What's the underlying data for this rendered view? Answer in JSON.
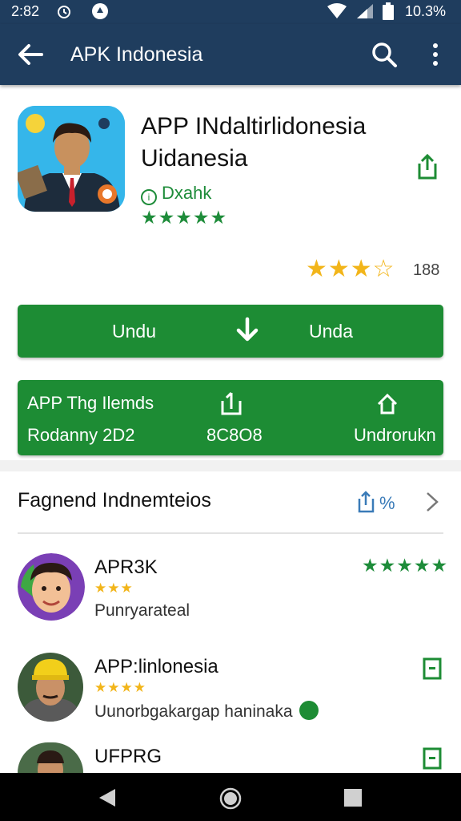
{
  "status": {
    "time": "2:82",
    "battery_text": "10.3%",
    "icons": [
      "alarm-icon",
      "notification-icon",
      "wifi-icon",
      "signal-icon",
      "battery-icon"
    ]
  },
  "appbar": {
    "title": "APK Indonesia",
    "icons": [
      "back-arrow-icon",
      "search-icon",
      "more-vert-icon"
    ]
  },
  "app": {
    "name_line1": "APP INdaltirlidonesia",
    "name_line2": "Uidanesia",
    "developer": "Dxahk",
    "developer_rating": "★★★★★",
    "rating_stars": "★★★☆",
    "rating_value": 3.5,
    "rating_count": "188"
  },
  "install": {
    "left_label": "Undu",
    "right_label": "Unda"
  },
  "info": {
    "line1": "APP  Thg Ilemds",
    "line2": "Rodanny  2D2",
    "mid_value": "8C8O8",
    "right_label": "Undrorukn"
  },
  "section": {
    "title": "Fagnend Indnemteios",
    "action_label": "%"
  },
  "list": [
    {
      "name": "APR3K",
      "stars": "★★★",
      "subtitle": "Punryarateal",
      "right_stars": "★★★★★"
    },
    {
      "name": "APP:linlonesia",
      "stars": "★★★★",
      "subtitle": "Uunorbgakargap haninaka"
    },
    {
      "name": "UFPRG",
      "stars": "",
      "subtitle": ""
    }
  ],
  "colors": {
    "appbar": "#1f3d5e",
    "primary_green": "#1d8c34",
    "star_yellow": "#f2b51a"
  }
}
